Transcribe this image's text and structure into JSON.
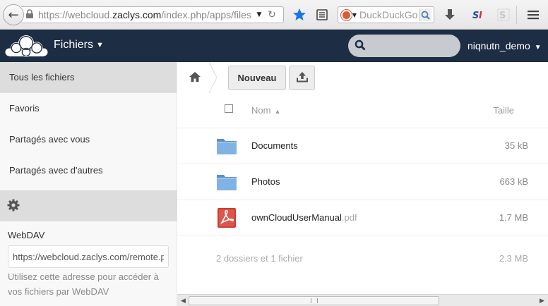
{
  "browser": {
    "url_prefix": "https://webcloud.",
    "url_domain": "zaclys.com",
    "url_suffix": "/index.php/apps/files",
    "search_placeholder": "DuckDuckGo"
  },
  "header": {
    "app_title": "Fichiers",
    "search_placeholder": "",
    "user_name": "niqnutn_demo"
  },
  "sidebar": {
    "items": [
      {
        "label": "Tous les fichiers",
        "active": true
      },
      {
        "label": "Favoris"
      },
      {
        "label": "Partagés avec vous"
      },
      {
        "label": "Partagés avec d'autres"
      }
    ],
    "webdav_label": "WebDAV",
    "webdav_url": "https://webcloud.zaclys.com/remote.php/webdav/",
    "webdav_hint": "Utilisez cette adresse pour accéder à vos fichiers par WebDAV"
  },
  "controls": {
    "new_label": "Nouveau"
  },
  "table": {
    "col_name": "Nom",
    "col_size": "Taille",
    "rows": [
      {
        "name": "Documents",
        "ext": "",
        "size": "35 kB",
        "type": "folder"
      },
      {
        "name": "Photos",
        "ext": "",
        "size": "663 kB",
        "type": "folder"
      },
      {
        "name": "ownCloudUserManual",
        "ext": ".pdf",
        "size": "1.7 MB",
        "type": "pdf"
      }
    ],
    "summary_text": "2 dossiers et 1 fichier",
    "summary_size": "2.3 MB"
  },
  "colors": {
    "header_bg": "#1d2d44",
    "folder": "#6fa4d6",
    "pdf": "#d43a2f",
    "bookmark_star": "#1a73e8"
  }
}
